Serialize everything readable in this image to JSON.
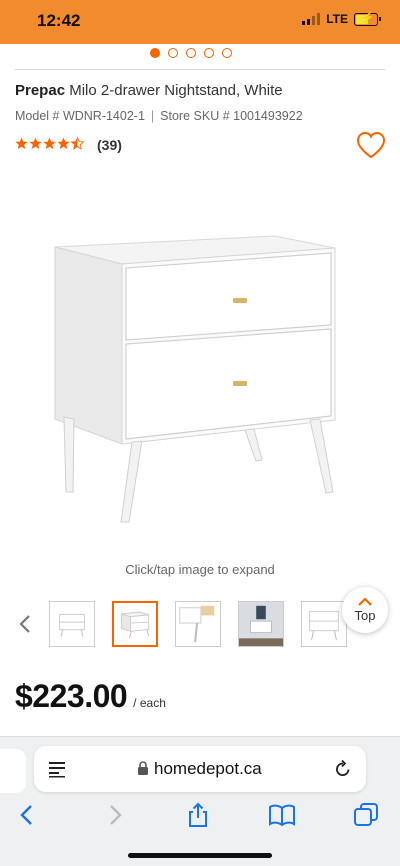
{
  "status_bar": {
    "time": "12:42",
    "network": "LTE"
  },
  "carousel": {
    "total_dots": 5,
    "active_dot": 1
  },
  "product": {
    "brand": "Prepac",
    "name": "Milo 2-drawer Nightstand, White",
    "model": "Model # WDNR-1402-1",
    "sku": "Store SKU # 1001493922",
    "rating": 4.5,
    "review_count": "(39)",
    "expand_hint": "Click/tap image to expand"
  },
  "thumbnails": [
    {
      "name": "thumb-front"
    },
    {
      "name": "thumb-angle",
      "selected": true
    },
    {
      "name": "thumb-open-drawer"
    },
    {
      "name": "thumb-room"
    },
    {
      "name": "thumb-side"
    }
  ],
  "top_button": {
    "label": "Top"
  },
  "price": {
    "amount": "$223.00",
    "unit": "/ each"
  },
  "browser": {
    "url": "homedepot.ca"
  },
  "colors": {
    "brand_orange": "#f96302",
    "status_bar": "#f28a2e",
    "ios_blue": "#1a73e8"
  }
}
